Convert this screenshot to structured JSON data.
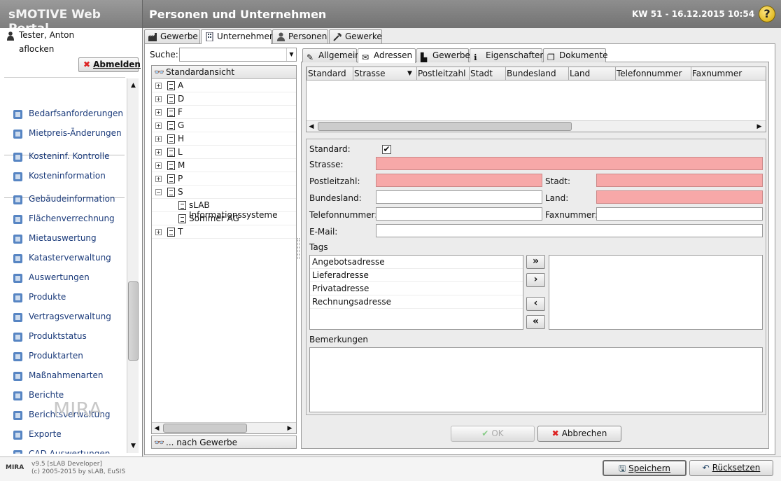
{
  "app": {
    "title": "sMOTIVE Web Portal",
    "page_title": "Personen und Unternehmen",
    "date_label": "KW 51 - 16.12.2015 10:54",
    "help": "?"
  },
  "user": {
    "name": "Tester, Anton",
    "login": "aflocken",
    "logout_label": "Abmelden"
  },
  "nav": {
    "items": [
      {
        "label": "Bedarfsanforderungen",
        "icon": "hand-pointer-icon"
      },
      {
        "label": "Mietpreis-Änderungen",
        "icon": "cash-register-icon"
      },
      {
        "label": "Kosteninf. Kontrolle",
        "icon": "coins-icon"
      },
      {
        "label": "Kosteninformation",
        "icon": "coins-icon"
      },
      {
        "label": "Gebäudeinformation",
        "icon": "building-icon"
      },
      {
        "label": "Flächenverrechnung",
        "icon": "building-icon"
      },
      {
        "label": "Mietauswertung",
        "icon": "house-chart-icon"
      },
      {
        "label": "Katasterverwaltung",
        "icon": "cadastre-icon"
      },
      {
        "label": "Auswertungen",
        "icon": "bar-chart-icon"
      },
      {
        "label": "Produkte",
        "icon": "product-icon"
      },
      {
        "label": "Vertragsverwaltung",
        "icon": "contract-icon"
      },
      {
        "label": "Produktstatus",
        "icon": "product-status-icon"
      },
      {
        "label": "Produktarten",
        "icon": "product-types-icon"
      },
      {
        "label": "Maßnahmenarten",
        "icon": "gears-icon"
      },
      {
        "label": "Berichte",
        "icon": "report-icon"
      },
      {
        "label": "Berichtsverwaltung",
        "icon": "report-admin-icon"
      },
      {
        "label": "Exporte",
        "icon": "export-icon"
      },
      {
        "label": "CAD Auswertungen",
        "icon": "cad-icon"
      }
    ]
  },
  "footer": {
    "version": "v9.5 [sLAB Developer]",
    "copyright": "(c) 2005-2015 by sLAB, EuSIS",
    "logo": "MIRA",
    "watermark": "MIRA",
    "save_label": "Speichern",
    "reset_label": "Rücksetzen"
  },
  "top_tabs": [
    {
      "label": "Gewerbe",
      "icon": "factory-icon"
    },
    {
      "label": "Unternehmen",
      "icon": "company-icon",
      "active": true
    },
    {
      "label": "Personen",
      "icon": "person-icon"
    },
    {
      "label": "Gewerke",
      "icon": "hammer-icon"
    }
  ],
  "search": {
    "label": "Suche:",
    "value": ""
  },
  "tree": {
    "header": "Standardansicht",
    "footer": "... nach Gewerbe",
    "nodes": [
      {
        "label": "A",
        "expanded": false
      },
      {
        "label": "D",
        "expanded": false
      },
      {
        "label": "F",
        "expanded": false
      },
      {
        "label": "G",
        "expanded": false
      },
      {
        "label": "H",
        "expanded": false
      },
      {
        "label": "L",
        "expanded": false
      },
      {
        "label": "M",
        "expanded": false
      },
      {
        "label": "P",
        "expanded": false
      },
      {
        "label": "S",
        "expanded": true
      },
      {
        "label": "sLAB Informationssysteme",
        "child": true
      },
      {
        "label": "Sommer AG",
        "child": true
      },
      {
        "label": "T",
        "expanded": false
      }
    ]
  },
  "detail_tabs": [
    {
      "label": "Allgemein"
    },
    {
      "label": "Adressen",
      "active": true
    },
    {
      "label": "Gewerbe"
    },
    {
      "label": "Eigenschaften"
    },
    {
      "label": "Dokumente"
    }
  ],
  "grid": {
    "columns": [
      "Standard",
      "Strasse",
      "Postleitzahl",
      "Stadt",
      "Bundesland",
      "Land",
      "Telefonnummer",
      "Faxnummer"
    ]
  },
  "form": {
    "standard_label": "Standard:",
    "standard_checked": "✔",
    "strasse_label": "Strasse:",
    "plz_label": "Postleitzahl:",
    "stadt_label": "Stadt:",
    "bundesland_label": "Bundesland:",
    "land_label": "Land:",
    "telefon_label": "Telefonnummer:",
    "fax_label": "Faxnummer:",
    "email_label": "E-Mail:",
    "tags_label": "Tags",
    "tags_available": [
      "Angebotsadresse",
      "Lieferadresse",
      "Privatadresse",
      "Rechnungsadresse"
    ],
    "bemerkungen_label": "Bemerkungen",
    "ok_label": "OK",
    "cancel_label": "Abbrechen"
  },
  "colors": {
    "required_field": "#f7a8a8",
    "header_bar": "#7e7e7e",
    "nav_text": "#1a3a7a"
  }
}
